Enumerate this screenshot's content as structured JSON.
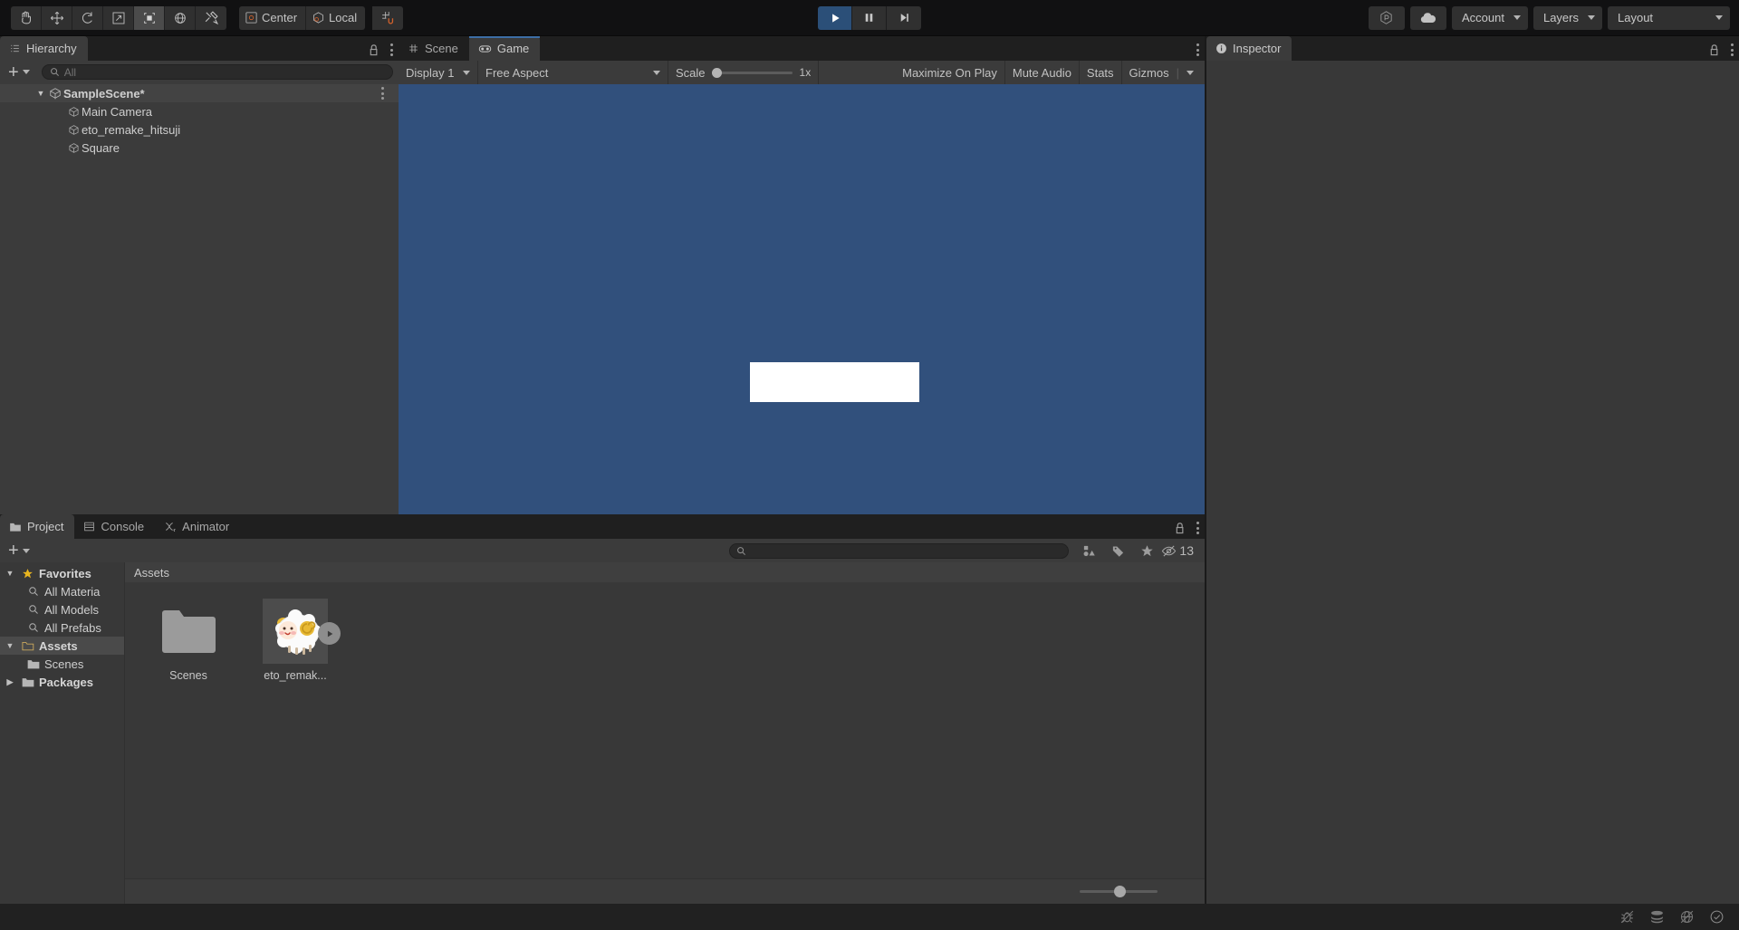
{
  "toolbar": {
    "tools": [
      {
        "name": "hand-tool",
        "icon": "hand",
        "active": false
      },
      {
        "name": "move-tool",
        "icon": "move",
        "active": false
      },
      {
        "name": "rotate-tool",
        "icon": "rotate",
        "active": false
      },
      {
        "name": "scale-tool",
        "icon": "scale",
        "active": false
      },
      {
        "name": "rect-tool",
        "icon": "rect",
        "active": true
      },
      {
        "name": "transform-tool",
        "icon": "transform",
        "active": false
      },
      {
        "name": "custom-tool",
        "icon": "wrench",
        "active": false
      }
    ],
    "pivot_label": "Center",
    "handle_label": "Local",
    "grid_snap_label": "",
    "play_label": "Play",
    "pause_label": "Pause",
    "step_label": "Step",
    "collab_label": "Collab",
    "cloud_label": "Cloud",
    "account_label": "Account",
    "layers_label": "Layers",
    "layout_label": "Layout"
  },
  "hierarchy": {
    "tab_label": "Hierarchy",
    "search_placeholder": "All",
    "create_label": "+",
    "scene_name": "SampleScene*",
    "objects": [
      {
        "label": "Main Camera"
      },
      {
        "label": "eto_remake_hitsuji"
      },
      {
        "label": "Square"
      }
    ]
  },
  "sceneview": {
    "tabs": [
      {
        "label": "Scene",
        "icon": "grid-icon",
        "active": false
      },
      {
        "label": "Game",
        "icon": "gamepad-icon",
        "active": true
      }
    ],
    "display_label": "Display 1",
    "aspect_label": "Free Aspect",
    "scale_label": "Scale",
    "scale_value": "1x",
    "maximize_label": "Maximize On Play",
    "mute_label": "Mute Audio",
    "stats_label": "Stats",
    "gizmos_label": "Gizmos",
    "background_color": "#31507c",
    "sprite_color": "#ffffff"
  },
  "inspector": {
    "tab_label": "Inspector"
  },
  "project": {
    "tabs": [
      {
        "label": "Project",
        "icon": "folder-icon",
        "active": true
      },
      {
        "label": "Console",
        "icon": "console-icon",
        "active": false
      },
      {
        "label": "Animator",
        "icon": "animator-icon",
        "active": false
      }
    ],
    "search_placeholder": "",
    "search_value": "",
    "hidden_count": "13",
    "breadcrumb": "Assets",
    "tree": [
      {
        "label": "Favorites",
        "icon": "star-icon",
        "expanded": true,
        "bold": true,
        "indent": false,
        "selected": false
      },
      {
        "label": "All Materia",
        "icon": "search-icon",
        "expanded": null,
        "bold": false,
        "indent": true,
        "selected": false
      },
      {
        "label": "All Models",
        "icon": "search-icon",
        "expanded": null,
        "bold": false,
        "indent": true,
        "selected": false
      },
      {
        "label": "All Prefabs",
        "icon": "search-icon",
        "expanded": null,
        "bold": false,
        "indent": true,
        "selected": false
      },
      {
        "label": "Assets",
        "icon": "folder-open-icon",
        "expanded": true,
        "bold": true,
        "indent": false,
        "selected": true
      },
      {
        "label": "Scenes",
        "icon": "folder-icon",
        "expanded": null,
        "bold": false,
        "indent": true,
        "selected": false
      },
      {
        "label": "Packages",
        "icon": "folder-icon",
        "expanded": false,
        "bold": true,
        "indent": false,
        "selected": false
      }
    ],
    "assets": [
      {
        "label": "Scenes",
        "type": "folder",
        "selected": false
      },
      {
        "label": "eto_remak...",
        "type": "sprite-sheet",
        "selected": true
      }
    ]
  },
  "statusbar": {
    "message": "",
    "icons": [
      "bug-slash-icon",
      "layers-icon",
      "globe-slash-icon",
      "check-circle-icon"
    ]
  }
}
